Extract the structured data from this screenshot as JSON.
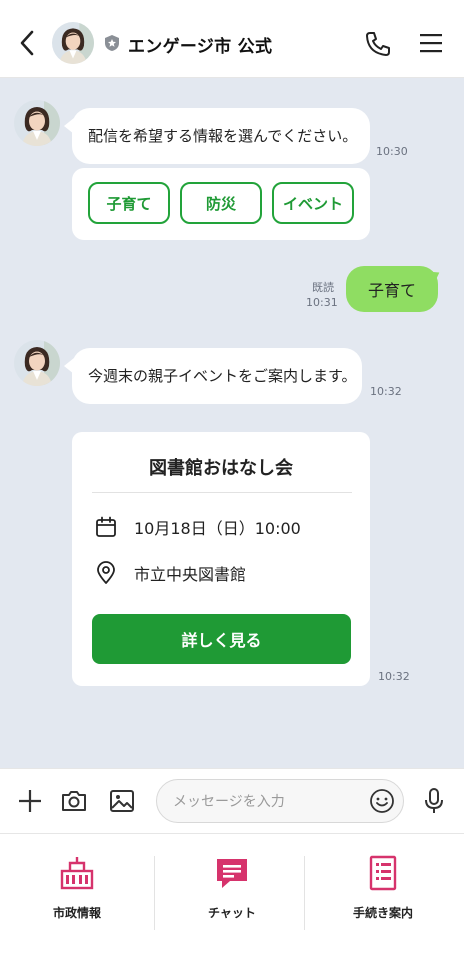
{
  "header": {
    "title": "エンゲージ市 公式",
    "back_icon": "chevron-left-icon",
    "verified_icon": "shield-badge-icon",
    "phone_icon": "phone-icon",
    "menu_icon": "hamburger-menu-icon"
  },
  "messages": [
    {
      "from": "official",
      "text": "配信を希望する情報を選んでください。",
      "time": "10:30"
    },
    {
      "from": "official-chips",
      "chips": [
        "子育て",
        "防災",
        "イベント"
      ]
    },
    {
      "from": "user",
      "text": "子育て",
      "read": "既読",
      "time": "10:31"
    },
    {
      "from": "official",
      "text": "今週末の親子イベントをご案内します。",
      "time": "10:32"
    },
    {
      "from": "official-card",
      "time": "10:32"
    }
  ],
  "event_card": {
    "title": "図書館おはなし会",
    "date": "10月18日（日）10:00",
    "place": "市立中央図書館",
    "button": "詳しく見る",
    "time": "10:32"
  },
  "input": {
    "placeholder": "メッセージを入力",
    "value": ""
  },
  "nav": [
    {
      "label": "市政情報",
      "icon": "city-hall-icon"
    },
    {
      "label": "チャット",
      "icon": "chat-icon"
    },
    {
      "label": "手続き案内",
      "icon": "document-list-icon"
    }
  ],
  "colors": {
    "accent_green": "#1f9a35",
    "user_bubble": "#8fdd62",
    "chat_bg": "#e3e8f0",
    "nav_pink": "#d6336c"
  }
}
